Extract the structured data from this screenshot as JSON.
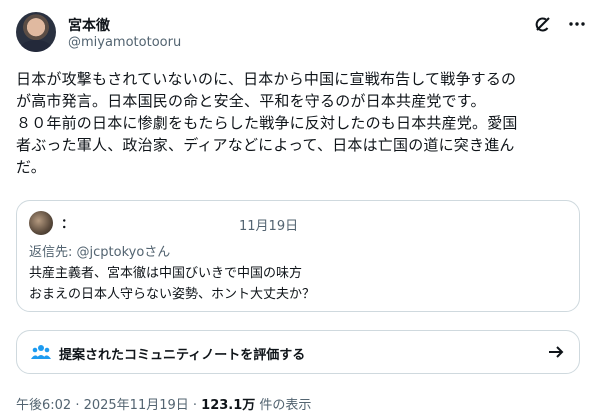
{
  "author": {
    "name": "宮本徹",
    "handle": "@miyamototooru"
  },
  "tweet": {
    "lines": [
      "日本が攻撃もされていないのに、日本から中国に宣戦布告して戦争するの",
      "が高市発言。日本国民の命と安全、平和を守るのが日本共産党です。",
      "８０年前の日本に惨劇をもたらした戦争に反対したのも日本共産党。愛国",
      "者ぶった軍人、政治家、ディアなどによって、日本は亡国の道に突き進ん",
      "だ。"
    ]
  },
  "quote": {
    "name": "：",
    "date": "11月19日",
    "reply_to": "返信先: @jcptokyoさん",
    "body_lines": [
      "共産主義者、宮本徹は中国びいきで中国の味方",
      "おまえの日本人守らない姿勢、ホント大丈夫か？"
    ]
  },
  "community_note": {
    "label": "提案されたコミュニティノートを評価する"
  },
  "meta": {
    "time": "午後6:02 · 2025年11月19日 · ",
    "views": "123.1万",
    "views_suffix": " 件の表示"
  },
  "icons": {
    "grok": "grok-icon",
    "more": "more-icon",
    "people": "people-icon",
    "arrow": "arrow-right-icon"
  },
  "colors": {
    "text": "#0f1419",
    "secondary": "#536471",
    "border": "#cfd9de",
    "accent": "#1d9bf0"
  }
}
